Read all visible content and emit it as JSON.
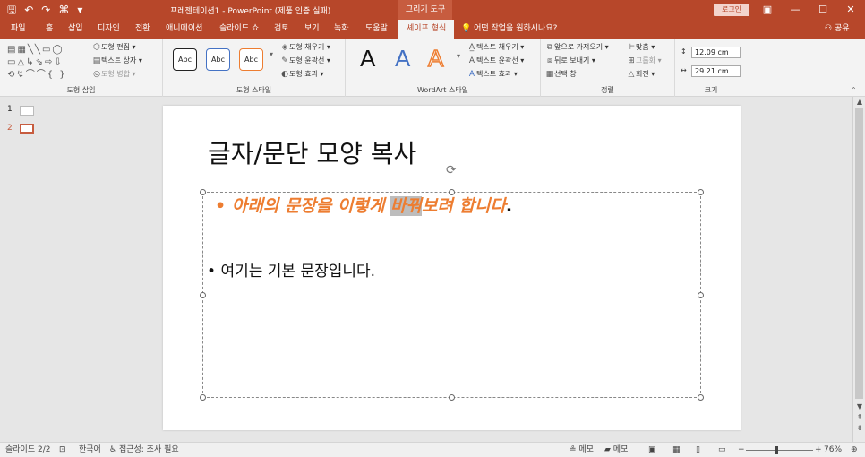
{
  "app": {
    "title": "프레젠테이션1  -  PowerPoint (제품 인증 실패)",
    "context_group": "그리기 도구",
    "login": "로그인",
    "tell_me": "어떤 작업을 원하시나요?",
    "share": "공유"
  },
  "tabs": [
    {
      "label": "파일"
    },
    {
      "label": "홈"
    },
    {
      "label": "삽입"
    },
    {
      "label": "디자인"
    },
    {
      "label": "전환"
    },
    {
      "label": "애니메이션"
    },
    {
      "label": "슬라이드 쇼"
    },
    {
      "label": "검토"
    },
    {
      "label": "보기"
    },
    {
      "label": "녹화"
    },
    {
      "label": "도움말"
    },
    {
      "label": "셰이프 형식"
    }
  ],
  "ribbon": {
    "insert_shapes": {
      "label": "도형 삽입",
      "edit_shape": "도형 편집",
      "text_box": "텍스트 상자",
      "merge_shapes": "도형 병합"
    },
    "shape_styles": {
      "label": "도형 스타일",
      "style_sample": "Abc",
      "fill": "도형 채우기",
      "outline": "도형 윤곽선",
      "effects": "도형 효과"
    },
    "wordart": {
      "label": "WordArt 스타일",
      "letter": "A",
      "text_fill": "텍스트 채우기",
      "text_outline": "텍스트 윤곽선",
      "text_effects": "텍스트 효과"
    },
    "arrange": {
      "label": "정렬",
      "bring_forward": "앞으로 가져오기",
      "send_backward": "뒤로 보내기",
      "selection_pane": "선택 창",
      "align": "맞춤",
      "group": "그룹화",
      "rotate": "회전"
    },
    "size": {
      "label": "크기",
      "height": "12.09 cm",
      "width": "29.21 cm"
    }
  },
  "slides_panel": [
    {
      "number": "1"
    },
    {
      "number": "2"
    }
  ],
  "slide": {
    "title": "글자/문단 모양 복사",
    "bullet1_before": "아래의 문장을 이렇게 ",
    "bullet1_highlight": "바꿔",
    "bullet1_after": "보려 합니다",
    "bullet1_tail": ".",
    "bullet2": "여기는 기본 문장입니다."
  },
  "status": {
    "slide_info": "슬라이드 2/2",
    "language": "한국어",
    "accessibility": "접근성: 조사 필요",
    "notes": "메모",
    "comments": "메모",
    "zoom": "76%"
  },
  "colors": {
    "accent": "#b7472a",
    "bullet_orange": "#ed7d31"
  }
}
